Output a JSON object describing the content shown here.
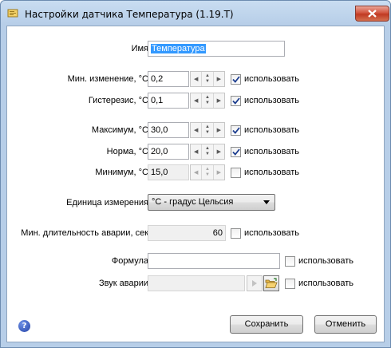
{
  "window": {
    "title": "Настройки датчика Температура (1.19.T)"
  },
  "name_field": {
    "label": "Имя",
    "value": "Температура"
  },
  "min_change": {
    "label": "Мин. изменение, °С",
    "value": "0,2",
    "use_label": "использовать",
    "checked": true
  },
  "hysteresis": {
    "label": "Гистерезис, °С",
    "value": "0,1",
    "use_label": "использовать",
    "checked": true
  },
  "maximum": {
    "label": "Максимум, °С",
    "value": "30,0",
    "use_label": "использовать",
    "checked": true
  },
  "norm": {
    "label": "Норма, °С",
    "value": "20,0",
    "use_label": "использовать",
    "checked": true
  },
  "minimum": {
    "label": "Минимум, °С",
    "value": "15,0",
    "use_label": "использовать",
    "checked": false
  },
  "unit": {
    "label": "Единица измерения",
    "selected": "°С - градус Цельсия"
  },
  "alarm_duration": {
    "label": "Мин. длительность аварии, сек",
    "value": "60",
    "use_label": "использовать",
    "checked": false
  },
  "formula": {
    "label": "Формула",
    "value": "",
    "use_label": "использовать",
    "checked": false
  },
  "alarm_sound": {
    "label": "Звук аварии",
    "value": "",
    "use_label": "использовать",
    "checked": false
  },
  "buttons": {
    "save": "Сохранить",
    "cancel": "Отменить"
  },
  "help": {
    "glyph": "?"
  },
  "colors": {
    "selection": "#3399ff",
    "checkmark": "#1c3d8f",
    "title_gradient_top": "#c9ddf1"
  }
}
